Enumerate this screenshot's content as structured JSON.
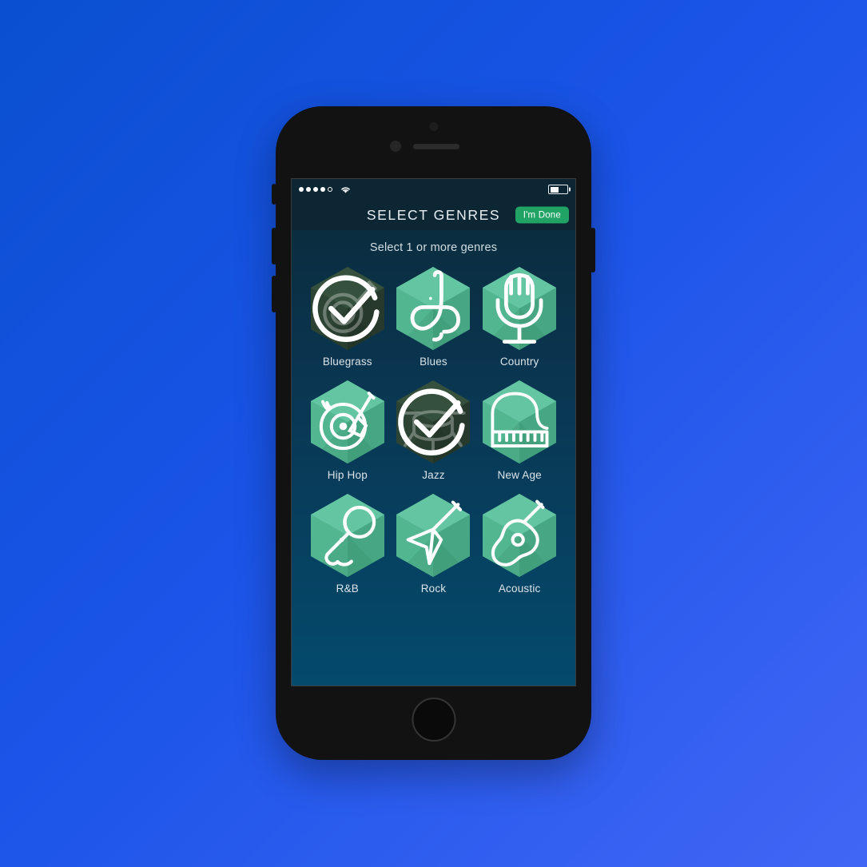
{
  "background": {
    "gradient_from": "#0a4fd0",
    "gradient_to": "#4166f5"
  },
  "device": {
    "name": "smartphone-mockup",
    "body_color": "#121212"
  },
  "status_bar": {
    "signal_dots_filled": 4,
    "signal_dots_total": 5,
    "wifi": "wifi-icon",
    "battery_percent": 52
  },
  "header": {
    "title": "SELECT GENRES",
    "done_label": "I'm Done",
    "done_color": "#21a366"
  },
  "main": {
    "subtitle": "Select 1 or more genres",
    "tile_color": "#52b691",
    "tile_selected_color": "#2c4433"
  },
  "genres": [
    {
      "label": "Bluegrass",
      "icon": "banjo-icon",
      "selected": true
    },
    {
      "label": "Blues",
      "icon": "saxophone-icon",
      "selected": false
    },
    {
      "label": "Country",
      "icon": "microphone-icon",
      "selected": false
    },
    {
      "label": "Hip Hop",
      "icon": "turntable-icon",
      "selected": false
    },
    {
      "label": "Jazz",
      "icon": "drum-kit-icon",
      "selected": true
    },
    {
      "label": "New Age",
      "icon": "grand-piano-icon",
      "selected": false
    },
    {
      "label": "R&B",
      "icon": "mic-handheld-icon",
      "selected": false
    },
    {
      "label": "Rock",
      "icon": "electric-guitar-icon",
      "selected": false
    },
    {
      "label": "Acoustic",
      "icon": "acoustic-guitar-icon",
      "selected": false
    }
  ]
}
